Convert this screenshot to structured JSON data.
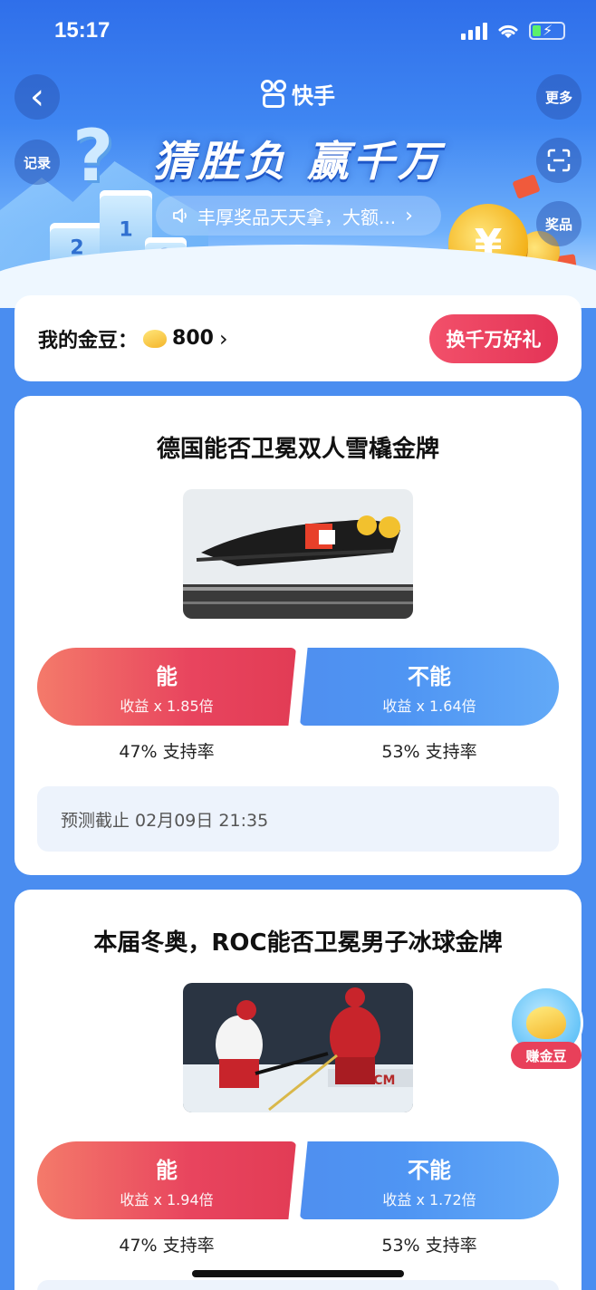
{
  "status": {
    "time": "15:17"
  },
  "header": {
    "back": "‹",
    "records": "记录",
    "more": "更多",
    "scan": "⊟",
    "prizes": "奖品",
    "app_name": "快手",
    "title": "猜胜负 赢千万",
    "subtitle": "丰厚奖品天天拿，大额...",
    "icons": [
      "back-icon",
      "speaker-icon",
      "chevron-right-icon",
      "scan-icon"
    ]
  },
  "beans": {
    "label": "我的金豆：",
    "value": "800",
    "arrow": "›",
    "exchange": "换千万好礼"
  },
  "questions": [
    {
      "title": "德国能否卫冕双人雪橇金牌",
      "yes_label": "能",
      "yes_odds": "收益 x 1.85倍",
      "no_label": "不能",
      "no_odds": "收益 x 1.64倍",
      "yes_rate": "47% 支持率",
      "no_rate": "53% 支持率",
      "deadline": "预测截止 02月09日 21:35"
    },
    {
      "title": "本届冬奥，ROC能否卫冕男子冰球金牌",
      "yes_label": "能",
      "yes_odds": "收益 x 1.94倍",
      "no_label": "不能",
      "no_odds": "收益 x 1.72倍",
      "yes_rate": "47% 支持率",
      "no_rate": "53% 支持率"
    }
  ],
  "earn": {
    "label": "赚金豆"
  },
  "colors": {
    "accent_red": "#e8445e",
    "accent_blue": "#4f8ff0",
    "background": "#4a8df0"
  }
}
